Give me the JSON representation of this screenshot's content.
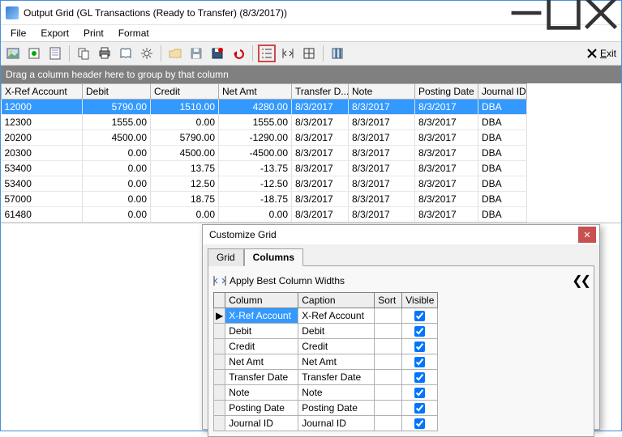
{
  "window": {
    "title": "Output Grid (GL Transactions (Ready to Transfer) (8/3/2017))"
  },
  "menu": {
    "file": "File",
    "export": "Export",
    "print": "Print",
    "format": "Format"
  },
  "exit": {
    "letter": "E",
    "rest": "xit"
  },
  "groupHeader": "Drag a column header here to group by that column",
  "columns": {
    "xref": "X-Ref Account",
    "debit": "Debit",
    "credit": "Credit",
    "net": "Net Amt",
    "tdate": "Transfer D...",
    "note": "Note",
    "pdate": "Posting Date",
    "jid": "Journal ID"
  },
  "rows": [
    {
      "xref": "12000",
      "debit": "5790.00",
      "credit": "1510.00",
      "net": "4280.00",
      "tdate": "8/3/2017",
      "note": "8/3/2017",
      "pdate": "8/3/2017",
      "jid": "DBA",
      "selected": true
    },
    {
      "xref": "12300",
      "debit": "1555.00",
      "credit": "0.00",
      "net": "1555.00",
      "tdate": "8/3/2017",
      "note": "8/3/2017",
      "pdate": "8/3/2017",
      "jid": "DBA"
    },
    {
      "xref": "20200",
      "debit": "4500.00",
      "credit": "5790.00",
      "net": "-1290.00",
      "tdate": "8/3/2017",
      "note": "8/3/2017",
      "pdate": "8/3/2017",
      "jid": "DBA"
    },
    {
      "xref": "20300",
      "debit": "0.00",
      "credit": "4500.00",
      "net": "-4500.00",
      "tdate": "8/3/2017",
      "note": "8/3/2017",
      "pdate": "8/3/2017",
      "jid": "DBA"
    },
    {
      "xref": "53400",
      "debit": "0.00",
      "credit": "13.75",
      "net": "-13.75",
      "tdate": "8/3/2017",
      "note": "8/3/2017",
      "pdate": "8/3/2017",
      "jid": "DBA"
    },
    {
      "xref": "53400",
      "debit": "0.00",
      "credit": "12.50",
      "net": "-12.50",
      "tdate": "8/3/2017",
      "note": "8/3/2017",
      "pdate": "8/3/2017",
      "jid": "DBA"
    },
    {
      "xref": "57000",
      "debit": "0.00",
      "credit": "18.75",
      "net": "-18.75",
      "tdate": "8/3/2017",
      "note": "8/3/2017",
      "pdate": "8/3/2017",
      "jid": "DBA"
    },
    {
      "xref": "61480",
      "debit": "0.00",
      "credit": "0.00",
      "net": "0.00",
      "tdate": "8/3/2017",
      "note": "8/3/2017",
      "pdate": "8/3/2017",
      "jid": "DBA"
    }
  ],
  "dialog": {
    "title": "Customize Grid",
    "tabs": {
      "grid": "Grid",
      "columns": "Columns"
    },
    "applyBest": "Apply Best Column Widths",
    "headers": {
      "column": "Column",
      "caption": "Caption",
      "sort": "Sort",
      "visible": "Visible"
    },
    "cols": [
      {
        "column": "X-Ref Account",
        "caption": "X-Ref Account",
        "visible": true,
        "selected": true
      },
      {
        "column": "Debit",
        "caption": "Debit",
        "visible": true
      },
      {
        "column": "Credit",
        "caption": "Credit",
        "visible": true
      },
      {
        "column": "Net Amt",
        "caption": "Net Amt",
        "visible": true
      },
      {
        "column": "Transfer Date",
        "caption": "Transfer Date",
        "visible": true
      },
      {
        "column": "Note",
        "caption": "Note",
        "visible": true
      },
      {
        "column": "Posting Date",
        "caption": "Posting Date",
        "visible": true
      },
      {
        "column": "Journal ID",
        "caption": "Journal ID",
        "visible": true
      }
    ]
  }
}
